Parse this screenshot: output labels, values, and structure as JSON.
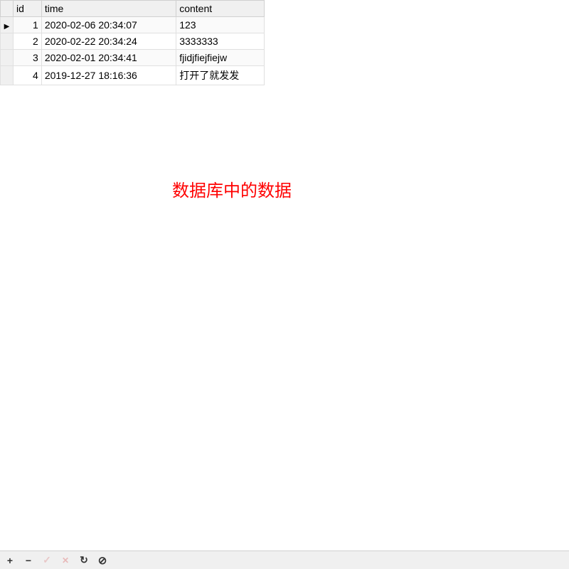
{
  "table": {
    "columns": {
      "id": "id",
      "time": "time",
      "content": "content"
    },
    "rows": [
      {
        "indicator": "▶",
        "id": "1",
        "time": "2020-02-06 20:34:07",
        "content": "123"
      },
      {
        "indicator": "",
        "id": "2",
        "time": "2020-02-22 20:34:24",
        "content": "3333333"
      },
      {
        "indicator": "",
        "id": "3",
        "time": "2020-02-01 20:34:41",
        "content": "fjidjfiejfiejw"
      },
      {
        "indicator": "",
        "id": "4",
        "time": "2019-12-27 18:16:36",
        "content": "打开了就发发"
      }
    ]
  },
  "annotation": "数据库中的数据",
  "toolbar": {
    "add": "+",
    "remove": "−",
    "commit": "✓",
    "revert": "✕",
    "refresh": "↻",
    "cancel": "⊘"
  }
}
